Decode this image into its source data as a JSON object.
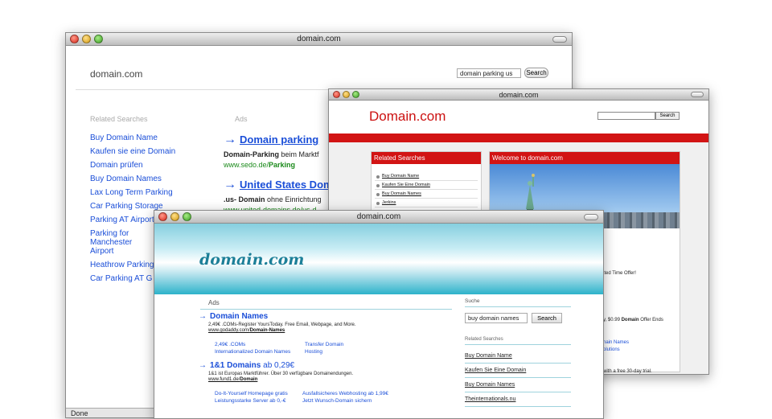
{
  "window1": {
    "title": "domain.com",
    "logo": "domain.com",
    "search_value": "domain parking us",
    "search_button": "Search",
    "related_heading": "Related Searches",
    "related": [
      "Buy Domain Name",
      "Kaufen sie eine Domain",
      "Domain prüfen",
      "Buy Domain Names",
      "Lax Long Term Parking",
      "Car Parking Storage",
      "Parking AT Airport",
      "Parking for Manchester Airport",
      "Heathrow Parking",
      "Car Parking AT G"
    ],
    "ads_heading": "Ads",
    "ad1": {
      "title": "Domain parking",
      "desc_bold": "Domain-Parking",
      "desc": " beim Marktf",
      "url_prefix": "www.sedo.de/",
      "url_bold": "Parking"
    },
    "ad2": {
      "title": "United States Dom",
      "desc_bold": ".us- Domain",
      "desc": " ohne Einrichtung",
      "url": "www.united-domains.de/us-d"
    },
    "status": "Done"
  },
  "window2": {
    "title": "domain.com",
    "site_title": "Domain.com",
    "search_button": "Search",
    "related_heading": "Related Searches",
    "related": [
      "Buy Domain Name",
      "Kaufen Sie Eine Domain",
      "Buy Domain Names",
      "Jerkins"
    ],
    "welcome_heading": "Welcome to domain.com",
    "text1": "ited Time Offer!",
    "text2_prefix": "y, $0.99 ",
    "text2_bold": "Domain",
    "text2_suffix": " Offer Ends",
    "link1": "nain Names",
    "link2": "olutions",
    "text3": "with a free 30-day trial."
  },
  "window3": {
    "title": "domain.com",
    "logo": "domain.com",
    "ads_heading": "Ads",
    "ad1": {
      "title": "Domain Names",
      "desc": "2,49€ .COMs-Register YoursToday. Free Email, Webpage, and More.",
      "url_prefix": "www.godaddy.com/",
      "url_bold": "Domain-Names",
      "sub": [
        "2,49€ .COMs",
        "Transfer Domain",
        "Internationalized Domain Names",
        "Hosting"
      ]
    },
    "ad2": {
      "title_bold": "1&1 Domains",
      "title_rest": " ab 0,29€",
      "desc": "1&1 ist Europas Marktführer. Über 30 verfügbare Domainendungen.",
      "url_prefix": "www.fund1.de/",
      "url_bold": "Domain",
      "sub": [
        "Do-It-Yourself Homepage gratis",
        "Ausfallsicheres Webhosting ab 1,99€",
        "Leistungsstarke Server ab 0,-€",
        "Jetzt Wunsch-Domain sichern"
      ]
    },
    "search_heading": "Suche",
    "search_value": "buy domain names",
    "search_button": "Search",
    "related_heading": "Related Searches",
    "related": [
      "Buy Domain Name",
      "Kaufen Sie Eine Domain",
      "Buy Domain Names",
      "Theinternationals.nu"
    ]
  }
}
